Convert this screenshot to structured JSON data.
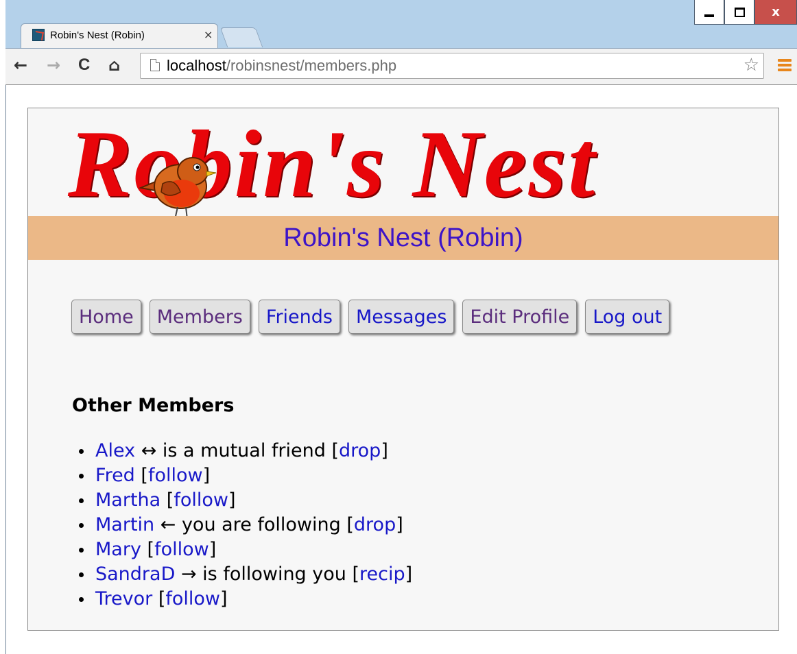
{
  "window": {
    "tab_title": "Robin's Nest (Robin)",
    "tab_close": "×",
    "close_glyph": "x"
  },
  "toolbar": {
    "back_glyph": "←",
    "forward_glyph": "→",
    "reload_glyph": "C",
    "home_glyph": "⌂",
    "url_host": "localhost",
    "url_path": "/robinsnest/members.php",
    "star_glyph": "☆"
  },
  "page": {
    "logo_text": "Robin's Nest",
    "banner": "Robin's Nest (Robin)",
    "nav": [
      {
        "label": "Home",
        "state": "visited"
      },
      {
        "label": "Members",
        "state": "visited"
      },
      {
        "label": "Friends",
        "state": "unvisited"
      },
      {
        "label": "Messages",
        "state": "unvisited"
      },
      {
        "label": "Edit Profile",
        "state": "visited"
      },
      {
        "label": "Log out",
        "state": "unvisited"
      }
    ],
    "heading": "Other Members",
    "members": [
      {
        "name": "Alex",
        "status": " ↔ is a mutual friend ",
        "action": "drop"
      },
      {
        "name": "Fred",
        "status": " ",
        "action": "follow"
      },
      {
        "name": "Martha",
        "status": " ",
        "action": "follow"
      },
      {
        "name": "Martin",
        "status": " ← you are following ",
        "action": "drop"
      },
      {
        "name": "Mary",
        "status": " ",
        "action": "follow"
      },
      {
        "name": "SandraD",
        "status": " → is following you ",
        "action": "recip"
      },
      {
        "name": "Trevor",
        "status": " ",
        "action": "follow"
      }
    ]
  },
  "colors": {
    "banner_bg": "#ebb887",
    "banner_text": "#3d14c8",
    "logo_red": "#e8050a",
    "link": "#1818c8",
    "visited_link": "#5b2d7d"
  }
}
